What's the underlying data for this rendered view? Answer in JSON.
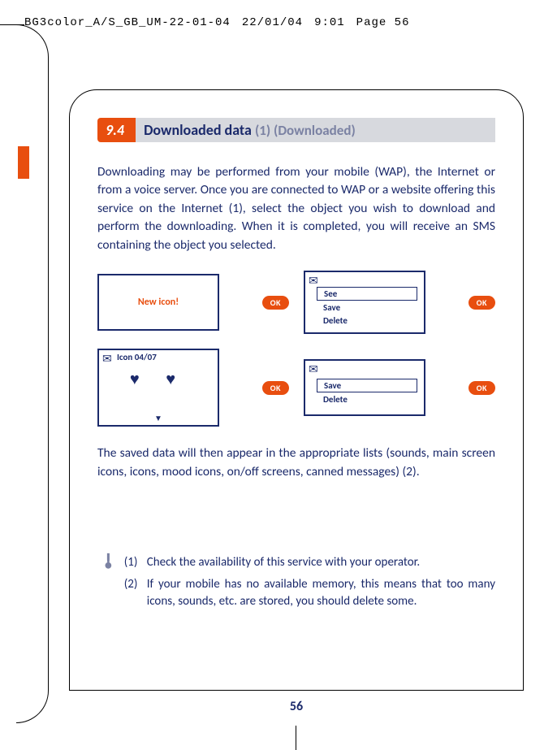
{
  "header": {
    "file": "BG3color_A/S_GB_UM-22-01-04",
    "date": "22/01/04",
    "time": "9:01",
    "page": "Page 56"
  },
  "section": {
    "number": "9.4",
    "title": "Downloaded data",
    "subtitle": "(1) (Downloaded)"
  },
  "intro": "Downloading may be performed from your mobile (WAP), the Internet or from a voice server. Once you are connected to WAP or a website offering this service on the Internet (1), select the object you wish to download and perform the downloading. When it is completed, you will receive an SMS containing the object you selected.",
  "screens": {
    "new_icon": "New icon!",
    "menu1": {
      "see": "See",
      "save": "Save",
      "delete": "Delete"
    },
    "icon_title": "Icon 04/07",
    "menu2": {
      "save": "Save",
      "delete": "Delete"
    },
    "ok": "OK"
  },
  "para2": "The saved data will then appear in the appropriate lists (sounds, main screen icons, icons, mood icons, on/off screens, canned messages) (2).",
  "footnotes": {
    "n1": "(1)",
    "t1": "Check the availability of this service with your operator.",
    "n2": "(2)",
    "t2": "If your mobile has no available memory, this means that too many icons, sounds, etc. are stored, you should delete some."
  },
  "page_number": "56"
}
